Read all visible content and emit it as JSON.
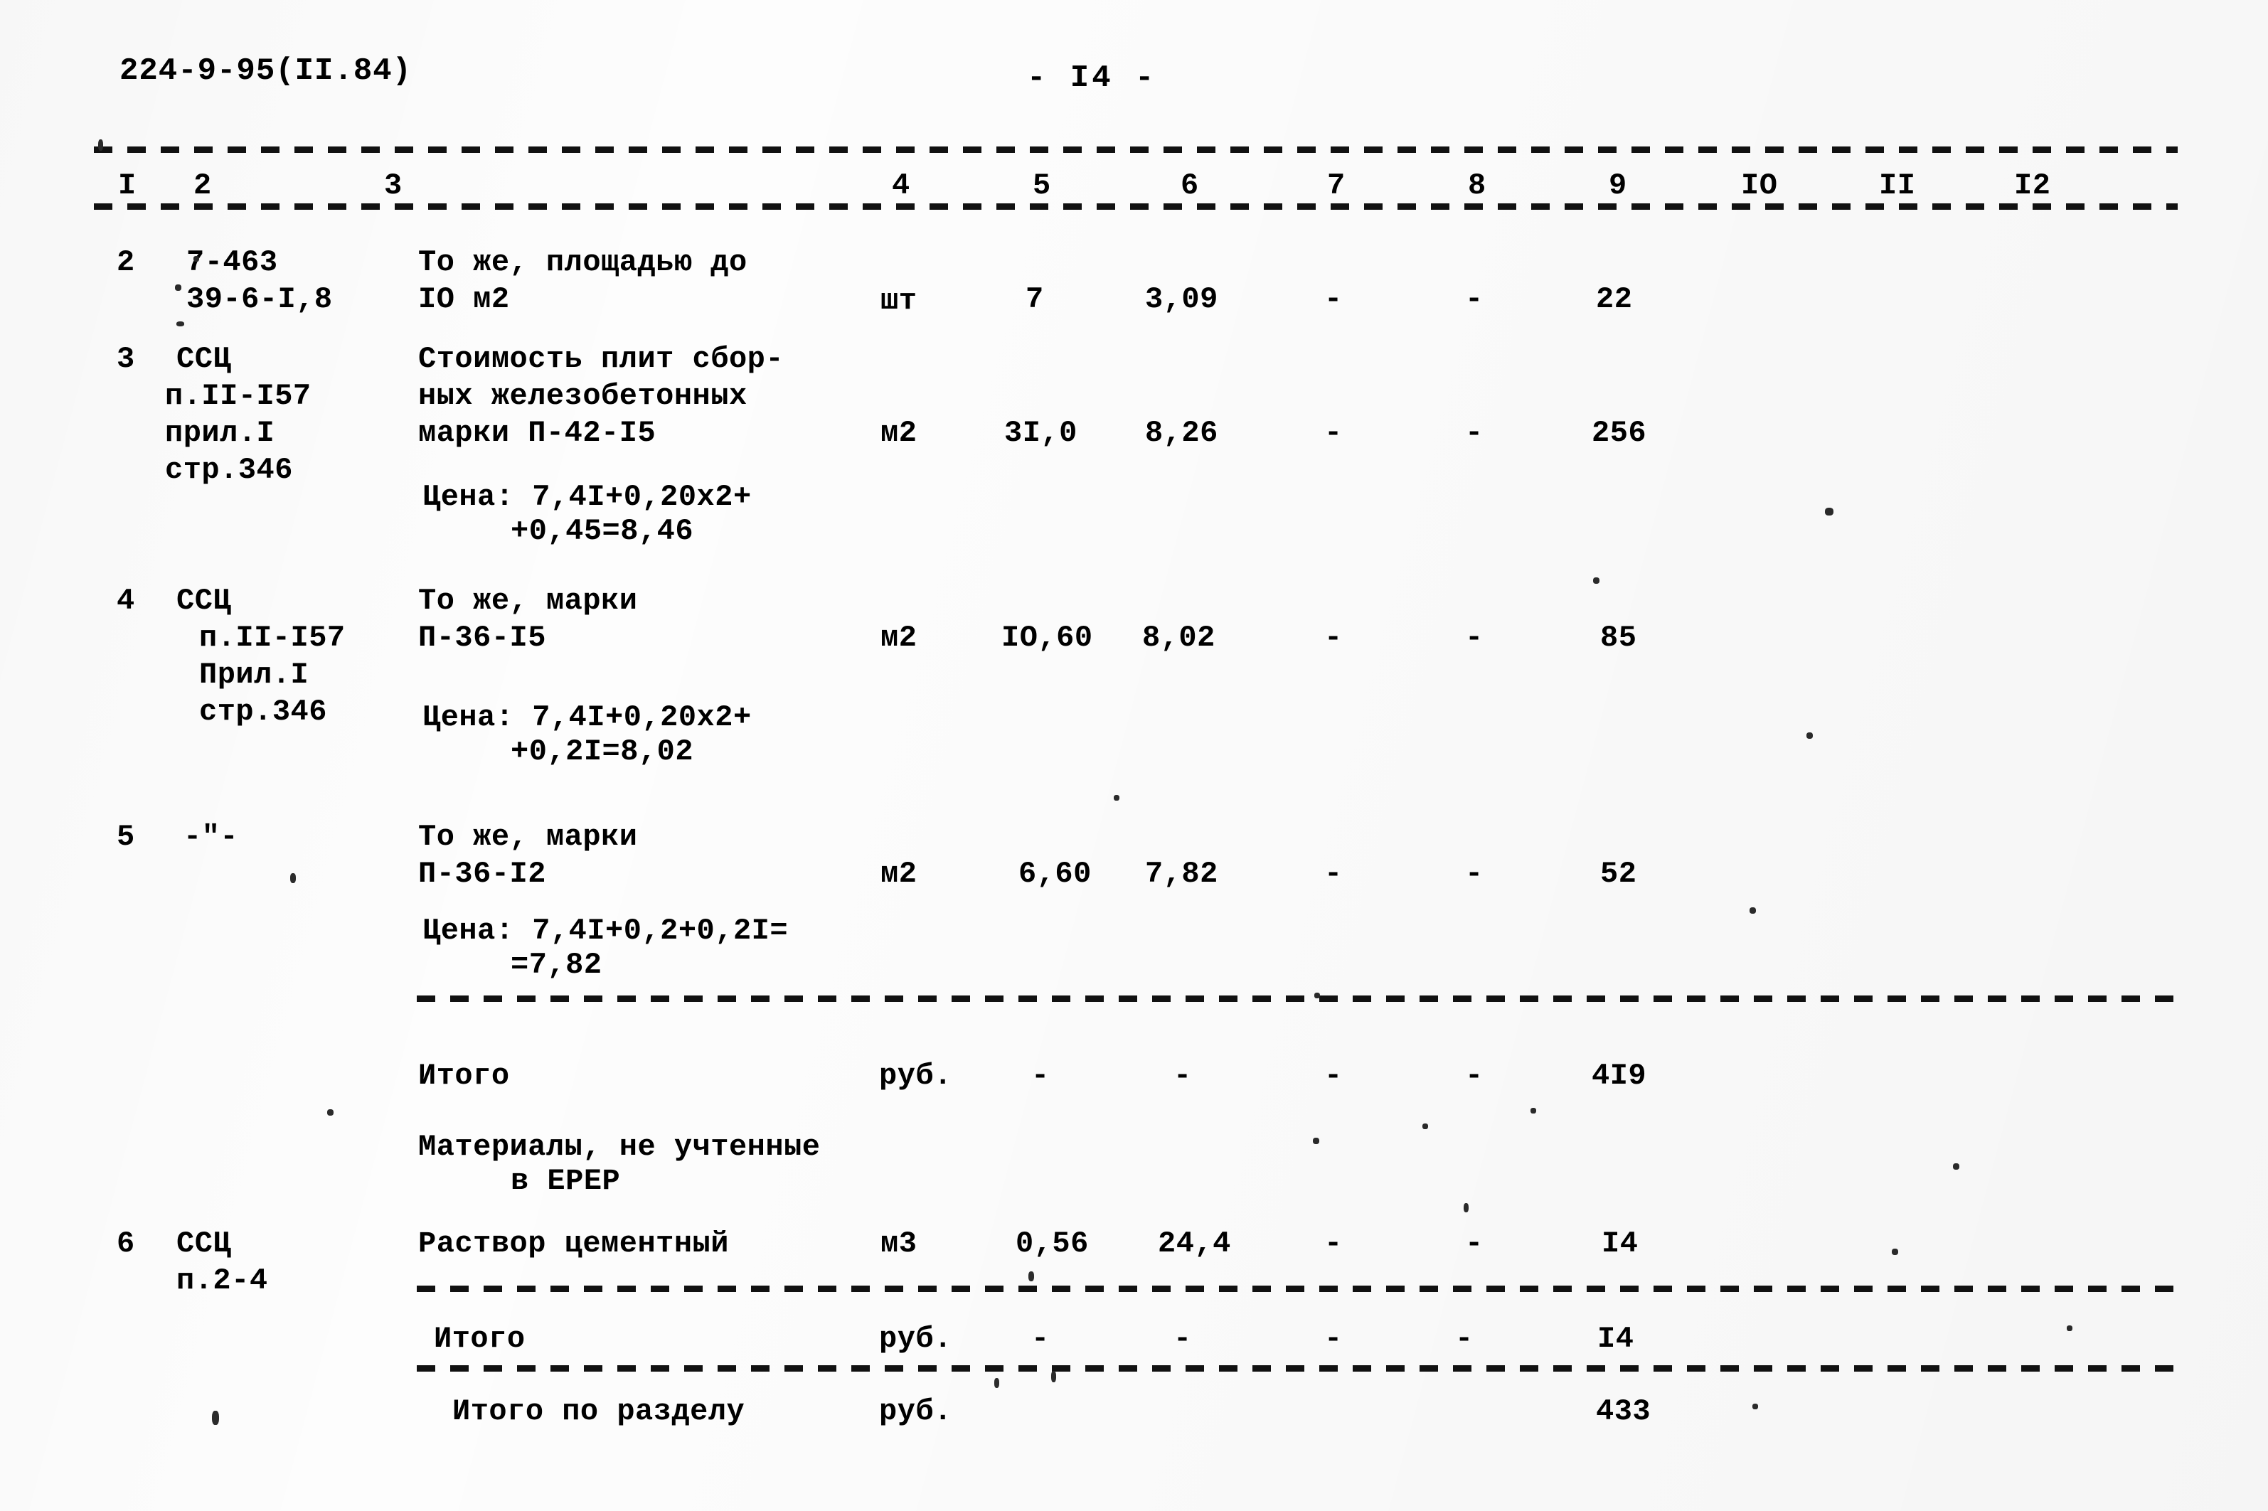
{
  "header": {
    "doc_code": "224-9-95(II.84)",
    "page_label": "- I4 -"
  },
  "table": {
    "column_headers": [
      "I",
      "2",
      "3",
      "4",
      "5",
      "6",
      "7",
      "8",
      "9",
      "IO",
      "II",
      "I2"
    ],
    "rows": [
      {
        "no": "2",
        "justification": [
          "7-463",
          "39-6-I,8"
        ],
        "description": [
          "То же, площадью до",
          "IO м2"
        ],
        "unit": "шт",
        "qty": "7",
        "price": "3,09",
        "c7": "-",
        "c8": "-",
        "total": "22"
      },
      {
        "no": "3",
        "justification": [
          "ССЦ",
          "п.II-I57",
          "прил.I",
          "стр.346"
        ],
        "description": [
          "Стоимость плит сбор-",
          "ных железобетонных",
          "марки П-42-I5"
        ],
        "unit": "м2",
        "qty": "3I,0",
        "price": "8,26",
        "c7": "-",
        "c8": "-",
        "total": "256",
        "note": [
          "Цена: 7,4I+0,20x2+",
          "+0,45=8,46"
        ]
      },
      {
        "no": "4",
        "justification": [
          "ССЦ",
          "п.II-I57",
          "Прил.I",
          "стр.346"
        ],
        "description": [
          "То же, марки",
          "П-36-I5"
        ],
        "unit": "м2",
        "qty": "IO,60",
        "price": "8,02",
        "c7": "-",
        "c8": "-",
        "total": "85",
        "note": [
          "Цена: 7,4I+0,20x2+",
          "+0,2I=8,02"
        ]
      },
      {
        "no": "5",
        "justification": [
          "-\"-"
        ],
        "description": [
          "То же, марки",
          "П-36-I2"
        ],
        "unit": "м2",
        "qty": "6,60",
        "price": "7,82",
        "c7": "-",
        "c8": "-",
        "total": "52",
        "note": [
          "Цена: 7,4I+0,2+0,2I=",
          "=7,82"
        ]
      }
    ],
    "subtotal_1": {
      "label": "Итого",
      "unit": "руб.",
      "qty": "-",
      "price": "-",
      "c7": "-",
      "c8": "-",
      "total": "4I9"
    },
    "section_note": [
      "Материалы, не учтенные",
      "в ЕРЕР"
    ],
    "row_materials": {
      "no": "6",
      "justification": [
        "ССЦ",
        "п.2-4"
      ],
      "description": "Раствор цементный",
      "unit": "м3",
      "qty": "0,56",
      "price": "24,4",
      "c7": "-",
      "c8": "-",
      "total": "I4"
    },
    "subtotal_2": {
      "label": "Итого",
      "unit": "руб.",
      "qty": "-",
      "price": "-",
      "c7": "-",
      "c8": "-",
      "total": "I4"
    },
    "grand_total": {
      "label": "Итого по разделу",
      "unit": "руб.",
      "total": "433"
    }
  }
}
